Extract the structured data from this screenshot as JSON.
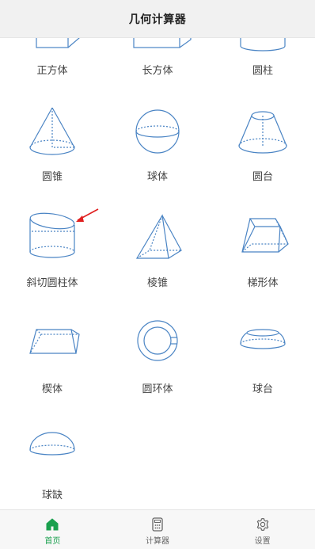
{
  "header": {
    "title": "几何计算器"
  },
  "shapes": [
    "正方体",
    "长方体",
    "圆柱",
    "圆锥",
    "球体",
    "圆台",
    "斜切圆柱体",
    "棱锥",
    "梯形体",
    "楔体",
    "圆环体",
    "球台",
    "球缺"
  ],
  "tabs": [
    {
      "label": "首页",
      "icon": "home-icon",
      "active": true
    },
    {
      "label": "计算器",
      "icon": "calculator-icon",
      "active": false
    },
    {
      "label": "设置",
      "icon": "gear-icon",
      "active": false
    }
  ],
  "colors": {
    "accent": "#1aa04e",
    "shape_stroke": "#4a84c4",
    "annotation_arrow": "#e02020"
  }
}
